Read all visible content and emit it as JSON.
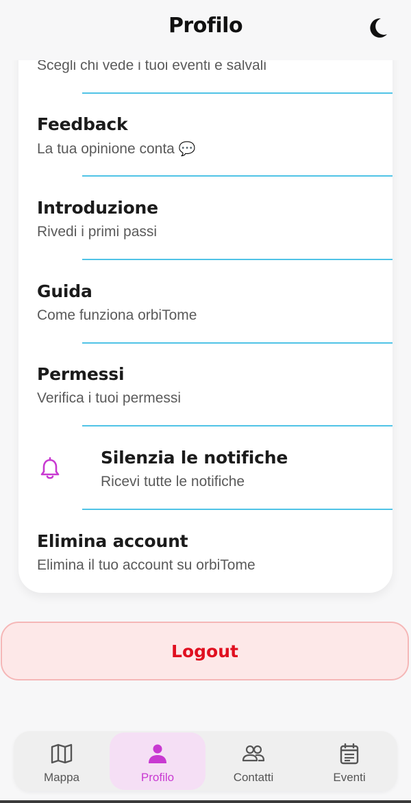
{
  "header": {
    "title": "Profilo",
    "theme_icon": "moon-icon"
  },
  "settings": {
    "privacy_sub": "Scegli chi vede i tuoi eventi e salvali",
    "items": [
      {
        "title": "Feedback",
        "subtitle": "La tua opinione conta",
        "emoji": "💬"
      },
      {
        "title": "Introduzione",
        "subtitle": "Rivedi i primi passi"
      },
      {
        "title": "Guida",
        "subtitle": "Come funziona orbiTome"
      },
      {
        "title": "Permessi",
        "subtitle": "Verifica i tuoi permessi"
      },
      {
        "title": "Silenzia le notifiche",
        "subtitle": "Ricevi tutte le notifiche",
        "icon": "bell-icon"
      },
      {
        "title": "Elimina account",
        "subtitle": "Elimina il tuo account su orbiTome"
      }
    ]
  },
  "logout": {
    "label": "Logout"
  },
  "nav": {
    "items": [
      {
        "label": "Mappa",
        "icon": "map-icon"
      },
      {
        "label": "Profilo",
        "icon": "person-icon",
        "active": true
      },
      {
        "label": "Contatti",
        "icon": "contacts-icon"
      },
      {
        "label": "Eventi",
        "icon": "calendar-icon"
      }
    ]
  },
  "colors": {
    "accent": "#c839d1",
    "divider": "#4fc3e6",
    "logout_text": "#e01020",
    "logout_bg": "#fde8e8"
  }
}
